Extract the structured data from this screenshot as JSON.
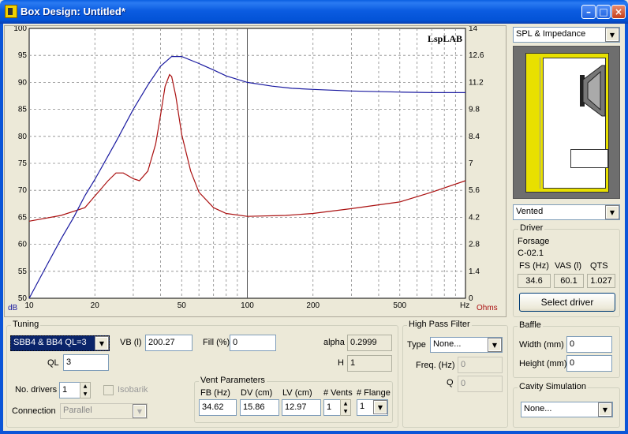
{
  "window": {
    "title": "Box Design: Untitled*",
    "min_glyph": "–",
    "max_glyph": "□",
    "close_glyph": "×"
  },
  "chart": {
    "watermark": "LspLAB",
    "left_unit": "dB",
    "right_unit": "Ohms",
    "x_unit": "Hz",
    "colors": {
      "spl": "#1a1aa0",
      "impedance": "#aa1010",
      "left_unit": "#1a1aa0",
      "right_unit": "#aa1010"
    }
  },
  "chart_data": {
    "type": "line",
    "xscale": "log",
    "xlim": [
      10,
      1000
    ],
    "x_ticks": [
      10,
      20,
      50,
      100,
      200,
      500
    ],
    "x_tick_labels": [
      "10",
      "20",
      "50",
      "100",
      "200",
      "500"
    ],
    "ylim_left": [
      50,
      100
    ],
    "y_left_ticks": [
      50,
      55,
      60,
      65,
      70,
      75,
      80,
      85,
      90,
      95,
      100
    ],
    "ylim_right": [
      0,
      14
    ],
    "y_right_ticks": [
      0,
      1.4,
      2.8,
      4.2,
      5.6,
      7,
      8.4,
      9.8,
      11.2,
      12.6,
      14
    ],
    "series": [
      {
        "axis": "left",
        "x": [
          10,
          12,
          14,
          16,
          18,
          20,
          25,
          30,
          35,
          40,
          45,
          50,
          60,
          70,
          80,
          100,
          130,
          160,
          200,
          300,
          500,
          700,
          1000
        ],
        "y": [
          50,
          56,
          61,
          65,
          69,
          72,
          79,
          85,
          89.5,
          93,
          94.8,
          94.8,
          93.5,
          92.3,
          91.2,
          90.0,
          89.3,
          88.9,
          88.7,
          88.4,
          88.2,
          88.1,
          88.1
        ]
      },
      {
        "axis": "right",
        "x": [
          10,
          14,
          18,
          20,
          23,
          25,
          27,
          30,
          32,
          35,
          38,
          40,
          42,
          44,
          45,
          47,
          50,
          55,
          60,
          70,
          80,
          100,
          150,
          200,
          300,
          500,
          700,
          1000
        ],
        "y": [
          4.0,
          4.3,
          4.7,
          5.3,
          6.1,
          6.5,
          6.5,
          6.2,
          6.1,
          6.6,
          8.0,
          9.5,
          11.0,
          11.6,
          11.5,
          10.5,
          8.5,
          6.6,
          5.5,
          4.7,
          4.4,
          4.25,
          4.3,
          4.4,
          4.65,
          5.0,
          5.5,
          6.1
        ]
      }
    ]
  },
  "right": {
    "graph_select": "SPL & Impedance",
    "box_type": "Vented",
    "driver_group": "Driver",
    "driver_brand": "Forsage",
    "driver_model": "C-02.1",
    "fs_label": "FS (Hz)",
    "fs_value": "34.6",
    "vas_label": "VAS (l)",
    "vas_value": "60.1",
    "qts_label": "QTS",
    "qts_value": "1.027",
    "select_driver": "Select driver"
  },
  "tuning": {
    "group": "Tuning",
    "alignment": "SBB4 & BB4 QL=3",
    "vb_label": "VB (l)",
    "vb_value": "200.27",
    "fill_label": "Fill (%)",
    "fill_value": "0",
    "alpha_label": "alpha",
    "alpha_value": "0.2999",
    "ql_label": "QL",
    "ql_value": "3",
    "h_label": "H",
    "h_value": "1",
    "drivers_label": "No. drivers",
    "drivers_value": "1",
    "isobarik_label": "Isobarik",
    "connection_label": "Connection",
    "connection_value": "Parallel",
    "spin_up": "▲",
    "spin_down": "▼",
    "vent": {
      "group": "Vent Parameters",
      "fb_label": "FB (Hz)",
      "fb_value": "34.62",
      "dv_label": "DV (cm)",
      "dv_value": "15.86",
      "lv_label": "LV (cm)",
      "lv_value": "12.97",
      "vents_label": "# Vents",
      "vents_value": "1",
      "flange_label": "# Flange",
      "flange_value": "1"
    }
  },
  "hpf": {
    "group": "High Pass Filter",
    "type_label": "Type",
    "type_value": "None...",
    "freq_label": "Freq. (Hz)",
    "freq_value": "0",
    "q_label": "Q",
    "q_value": "0"
  },
  "baffle": {
    "group": "Baffle",
    "width_label": "Width (mm)",
    "width_value": "0",
    "height_label": "Height (mm)",
    "height_value": "0"
  },
  "cavity": {
    "group": "Cavity Simulation",
    "value": "None..."
  },
  "arrow_glyph": "▼"
}
